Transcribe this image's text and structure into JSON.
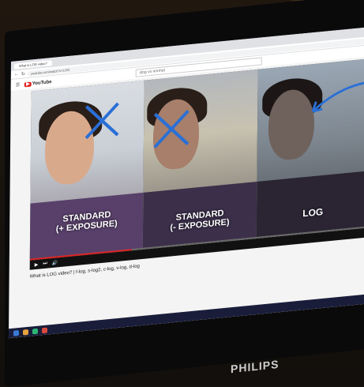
{
  "browser": {
    "tab_title": "What is LOG video?",
    "address": "youtube.com/watch?v=LOG",
    "search_text": "slog vs normal"
  },
  "youtube": {
    "logo": "YouTube"
  },
  "video": {
    "panels": [
      {
        "caption_line1": "STANDARD",
        "caption_line2": "(+ EXPOSURE)"
      },
      {
        "caption_line1": "STANDARD",
        "caption_line2": "(- EXPOSURE)"
      },
      {
        "caption_line1": "LOG",
        "caption_line2": ""
      }
    ],
    "title": "What is LOG video? | f-log, s-log2, c-log, v-log, d-log",
    "progress": 0.3
  },
  "monitor": {
    "brand": "PHILIPS"
  },
  "colors": {
    "accent_blue": "#2a6fd6",
    "youtube_red": "#e02020"
  }
}
